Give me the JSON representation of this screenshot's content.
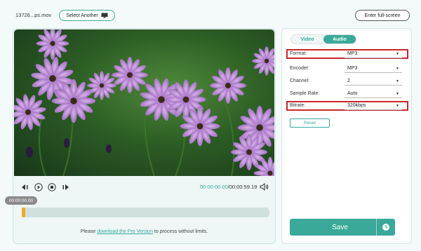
{
  "topbar": {
    "filename": "13726...ps.mov",
    "select_another_label": "Select Another",
    "fullscreen_label": "Enter full-screen"
  },
  "player": {
    "current_time": "00:00:00.00",
    "total_time": "/00:00:59.19",
    "timeline_tag": "00:00:00.00",
    "progress": 0,
    "promo_prefix": "Please ",
    "promo_link": "download the Pro Version",
    "promo_suffix": " to process without limits."
  },
  "settings": {
    "tabs": [
      {
        "label": "Video",
        "active": false
      },
      {
        "label": "Audio",
        "active": true
      }
    ],
    "rows": [
      {
        "label": "Format:",
        "value": "MP3",
        "highlighted": true
      },
      {
        "label": "Encoder:",
        "value": "MP3",
        "highlighted": false
      },
      {
        "label": "Channel:",
        "value": "2",
        "highlighted": false
      },
      {
        "label": "Sample Rate:",
        "value": "Auto",
        "highlighted": false
      },
      {
        "label": "Bitrate:",
        "value": "320kbps",
        "highlighted": true
      }
    ],
    "reset_label": "Reset",
    "save_label": "Save"
  },
  "colors": {
    "accent": "#3aa99a",
    "highlight": "#c9262f",
    "handle": "#f5a623"
  },
  "icons": [
    "monitor-icon",
    "previous-frame-icon",
    "play-icon",
    "stop-icon",
    "next-frame-icon",
    "volume-icon",
    "clock-icon",
    "dropdown-caret-icon"
  ]
}
